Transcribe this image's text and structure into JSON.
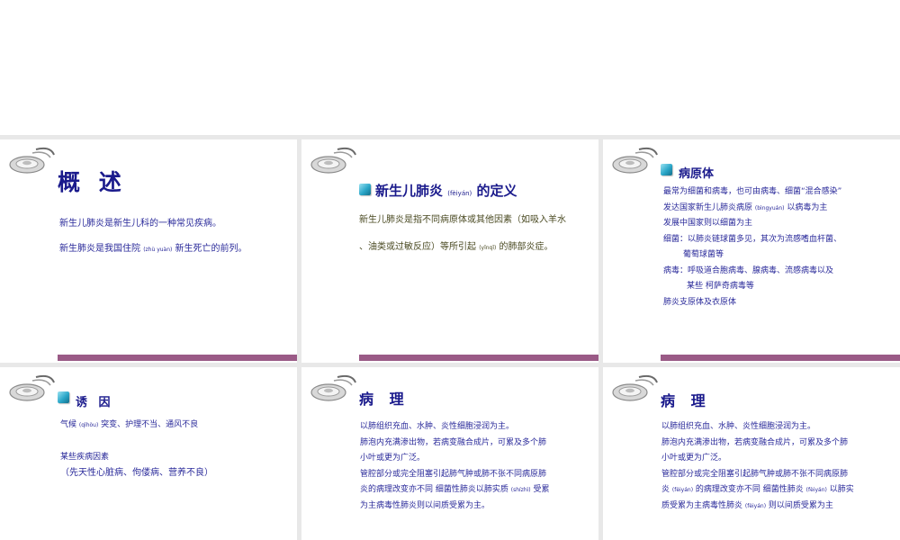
{
  "slides": [
    {
      "title": "概 述",
      "lines": [
        "新生儿肺炎是新生儿科的一种常见疾病。"
      ],
      "line2_pre": "新生肺炎是我国住院 ",
      "line2_py": "(zhù yuàn)",
      "line2_post": " 新生死亡的前列。"
    },
    {
      "title_pre": "新生儿肺炎 ",
      "title_py": "(fèiyán)",
      "title_post": " 的定义",
      "line1": "新生儿肺炎是指不同病原体或其他因素（如吸入羊水",
      "line2_pre": "、油类或过敏反应）等所引起 ",
      "line2_py": "(yǐnqǐ)",
      "line2_post": " 的肺部炎症。"
    },
    {
      "title": "病原体",
      "l1": "最常为细菌和病毒，也可由病毒、细菌“混合感染”",
      "l2_pre": "发达国家新生儿肺炎病原 ",
      "l2_py": "(bìngyuán)",
      "l2_post": " 以病毒为主",
      "l3": "发展中国家则以细菌为主",
      "l4": "细菌：以肺炎链球菌多见，其次为流感嗜血杆菌、",
      "l5": "葡萄球菌等",
      "l6": "病毒：呼吸道合胞病毒、腺病毒、流感病毒以及",
      "l7": "某些 柯萨奇病毒等",
      "l8": "肺炎支原体及衣原体"
    },
    {
      "title": "诱 因",
      "l1_pre": "气候 ",
      "l1_py": "(qìhòu)",
      "l1_post": " 突变、护理不当、通风不良",
      "l2": "某些疾病因素",
      "l3": "（先天性心脏病、佝偻病、营养不良）"
    },
    {
      "title": "病 理",
      "l1": "以肺组织充血、水肿、炎性细胞浸润为主。",
      "l2": "肺泡内充满渗出物，若病变融合成片，可累及多个肺",
      "l3": "小叶或更为广泛。",
      "l4": "管腔部分或完全阻塞引起肺气肿或肺不张不同病原肺",
      "l5_pre": "炎的病理改变亦不同 细菌性肺炎以肺实质 ",
      "l5_py": "(shízhì)",
      "l5_post": " 受累",
      "l6": "为主病毒性肺炎则以间质受累为主。"
    },
    {
      "title": "病 理",
      "l1": "以肺组织充血、水肿、炎性细胞浸润为主。",
      "l2": "肺泡内充满渗出物，若病变融合成片，可累及多个肺",
      "l3": "小叶或更为广泛。",
      "l4": "管腔部分或完全阻塞引起肺气肿或肺不张不同病原肺",
      "l5_a": "炎 ",
      "l5_py1": "(fèiyán)",
      "l5_b": " 的病理改变亦不同 细菌性肺炎 ",
      "l5_py2": "(fèiyán)",
      "l5_c": " 以肺实",
      "l6_a": "质受累为主病毒性肺炎 ",
      "l6_py": "(fèiyán)",
      "l6_b": " 则以间质受累为主"
    }
  ],
  "colors": {
    "title": "#1a1a8c",
    "text": "#2a2a9a",
    "footer_bar": "#9a5a86",
    "background": "#e8e8e8"
  },
  "icons": [
    "stethoscope-icon",
    "cube-bullet-icon"
  ]
}
